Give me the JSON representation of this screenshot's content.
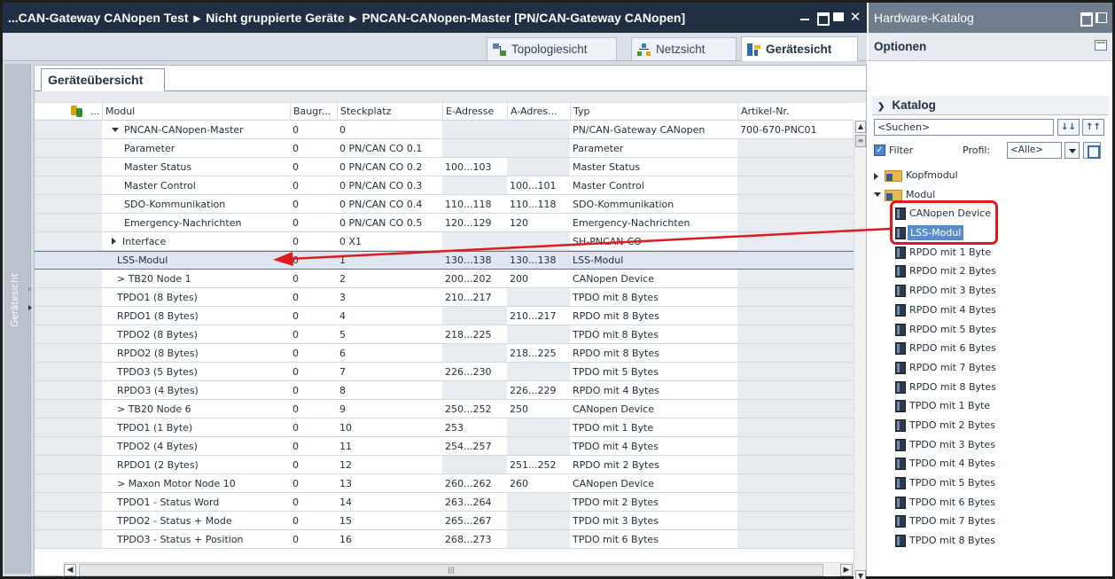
{
  "window": {
    "breadcrumb": [
      "...CAN-Gateway CANopen Test",
      "Nicht gruppierte Geräte",
      "PNCAN-CANopen-Master [PN/CAN-Gateway CANopen]"
    ]
  },
  "view_tabs": [
    {
      "label": "Topologiesicht",
      "icon": "topology-icon"
    },
    {
      "label": "Netzsicht",
      "icon": "network-icon"
    },
    {
      "label": "Gerätesicht",
      "icon": "device-icon",
      "active": true
    }
  ],
  "side_label": "Gerätesicht",
  "panel_tab": "Geräteübersicht",
  "table": {
    "columns": {
      "dots": "...",
      "modul": "Modul",
      "baugr": "Baugr...",
      "steck": "Steckplatz",
      "eaddr": "E-Adresse",
      "aaddr": "A-Adres...",
      "typ": "Typ",
      "artikel": "Artikel-Nr."
    },
    "rows": [
      {
        "modul": "PNCAN-CANopen-Master",
        "indent": 0,
        "exp": "down",
        "baugr": "0",
        "steck": "0",
        "eaddr": "",
        "aaddr": "",
        "typ": "PN/CAN-Gateway CANopen",
        "artikel": "700-670-PNC01"
      },
      {
        "modul": "Parameter",
        "indent": 2,
        "baugr": "0",
        "steck": "0 PN/CAN CO 0.1",
        "eaddr": "",
        "aaddr": "",
        "typ": "Parameter",
        "artikel": ""
      },
      {
        "modul": "Master Status",
        "indent": 2,
        "baugr": "0",
        "steck": "0 PN/CAN CO 0.2",
        "eaddr": "100...103",
        "aaddr": "",
        "typ": "Master Status",
        "artikel": ""
      },
      {
        "modul": "Master Control",
        "indent": 2,
        "baugr": "0",
        "steck": "0 PN/CAN CO 0.3",
        "eaddr": "",
        "aaddr": "100...101",
        "typ": "Master Control",
        "artikel": ""
      },
      {
        "modul": "SDO-Kommunikation",
        "indent": 2,
        "baugr": "0",
        "steck": "0 PN/CAN CO 0.4",
        "eaddr": "110...118",
        "aaddr": "110...118",
        "typ": "SDO-Kommunikation",
        "artikel": ""
      },
      {
        "modul": "Emergency-Nachrichten",
        "indent": 2,
        "baugr": "0",
        "steck": "0 PN/CAN CO 0.5",
        "eaddr": "120...129",
        "aaddr": "120",
        "typ": "Emergency-Nachrichten",
        "artikel": ""
      },
      {
        "modul": "Interface",
        "indent": 1,
        "exp": "right",
        "baugr": "0",
        "steck": "0 X1",
        "eaddr": "",
        "aaddr": "",
        "typ": "SH-PNCAN-CO",
        "artikel": ""
      },
      {
        "modul": "LSS-Modul",
        "indent": 0,
        "selected": true,
        "baugr": "0",
        "steck": "1",
        "eaddr": "130...138",
        "aaddr": "130...138",
        "typ": "LSS-Modul",
        "artikel": ""
      },
      {
        "modul": "> TB20 Node 1",
        "indent": 0,
        "baugr": "0",
        "steck": "2",
        "eaddr": "200...202",
        "aaddr": "200",
        "typ": "CANopen Device",
        "artikel": ""
      },
      {
        "modul": "TPDO1 (8 Bytes)",
        "indent": 0,
        "baugr": "0",
        "steck": "3",
        "eaddr": "210...217",
        "aaddr": "",
        "typ": "TPDO mit 8 Bytes",
        "artikel": ""
      },
      {
        "modul": "RPDO1 (8 Bytes)",
        "indent": 0,
        "baugr": "0",
        "steck": "4",
        "eaddr": "",
        "aaddr": "210...217",
        "typ": "RPDO mit 8 Bytes",
        "artikel": ""
      },
      {
        "modul": "TPDO2 (8 Bytes)",
        "indent": 0,
        "baugr": "0",
        "steck": "5",
        "eaddr": "218...225",
        "aaddr": "",
        "typ": "TPDO mit 8 Bytes",
        "artikel": ""
      },
      {
        "modul": "RPDO2 (8 Bytes)",
        "indent": 0,
        "baugr": "0",
        "steck": "6",
        "eaddr": "",
        "aaddr": "218...225",
        "typ": "RPDO mit 8 Bytes",
        "artikel": ""
      },
      {
        "modul": "TPDO3 (5 Bytes)",
        "indent": 0,
        "baugr": "0",
        "steck": "7",
        "eaddr": "226...230",
        "aaddr": "",
        "typ": "TPDO mit 5 Bytes",
        "artikel": ""
      },
      {
        "modul": "RPDO3 (4 Bytes)",
        "indent": 0,
        "baugr": "0",
        "steck": "8",
        "eaddr": "",
        "aaddr": "226...229",
        "typ": "RPDO mit 4 Bytes",
        "artikel": ""
      },
      {
        "modul": "> TB20 Node 6",
        "indent": 0,
        "baugr": "0",
        "steck": "9",
        "eaddr": "250...252",
        "aaddr": "250",
        "typ": "CANopen Device",
        "artikel": ""
      },
      {
        "modul": "TPDO1 (1 Byte)",
        "indent": 0,
        "baugr": "0",
        "steck": "10",
        "eaddr": "253",
        "aaddr": "",
        "typ": "TPDO mit 1 Byte",
        "artikel": ""
      },
      {
        "modul": "TPDO2 (4 Bytes)",
        "indent": 0,
        "baugr": "0",
        "steck": "11",
        "eaddr": "254...257",
        "aaddr": "",
        "typ": "TPDO mit 4 Bytes",
        "artikel": ""
      },
      {
        "modul": "RPDO1 (2 Bytes)",
        "indent": 0,
        "baugr": "0",
        "steck": "12",
        "eaddr": "",
        "aaddr": "251...252",
        "typ": "RPDO mit 2 Bytes",
        "artikel": ""
      },
      {
        "modul": "> Maxon Motor Node 10",
        "indent": 0,
        "baugr": "0",
        "steck": "13",
        "eaddr": "260...262",
        "aaddr": "260",
        "typ": "CANopen Device",
        "artikel": ""
      },
      {
        "modul": "TPDO1 - Status Word",
        "indent": 0,
        "baugr": "0",
        "steck": "14",
        "eaddr": "263...264",
        "aaddr": "",
        "typ": "TPDO mit 2 Bytes",
        "artikel": ""
      },
      {
        "modul": "TPDO2 - Status + Mode",
        "indent": 0,
        "baugr": "0",
        "steck": "15",
        "eaddr": "265...267",
        "aaddr": "",
        "typ": "TPDO mit 3 Bytes",
        "artikel": ""
      },
      {
        "modul": "TPDO3 - Status + Position",
        "indent": 0,
        "baugr": "0",
        "steck": "16",
        "eaddr": "268...273",
        "aaddr": "",
        "typ": "TPDO mit 6 Bytes",
        "artikel": ""
      }
    ]
  },
  "catalog": {
    "title": "Hardware-Katalog",
    "options": "Optionen",
    "katalog": "Katalog",
    "search_value": "<Suchen>",
    "filter_label": "Filter",
    "profil_label": "Profil:",
    "profil_value": "<Alle>",
    "folders": [
      {
        "label": "Kopfmodul",
        "expanded": false
      },
      {
        "label": "Modul",
        "expanded": true
      }
    ],
    "items": [
      "CANopen Device",
      "LSS-Modul",
      "RPDO mit 1 Byte",
      "RPDO mit 2 Bytes",
      "RPDO mit 3 Bytes",
      "RPDO mit 4 Bytes",
      "RPDO mit 5 Bytes",
      "RPDO mit 6 Bytes",
      "RPDO mit 7 Bytes",
      "RPDO mit 8 Bytes",
      "TPDO mit 1 Byte",
      "TPDO mit 2 Bytes",
      "TPDO mit 3 Bytes",
      "TPDO mit 4 Bytes",
      "TPDO mit 5 Bytes",
      "TPDO mit 6 Bytes",
      "TPDO mit 7 Bytes",
      "TPDO mit 8 Bytes"
    ],
    "selected_item": "LSS-Modul"
  },
  "colors": {
    "titlebar": "#202f44",
    "catalog_titlebar": "#6f7d8e",
    "annotation": "#e0191c",
    "selection": "#5a8ccc"
  }
}
